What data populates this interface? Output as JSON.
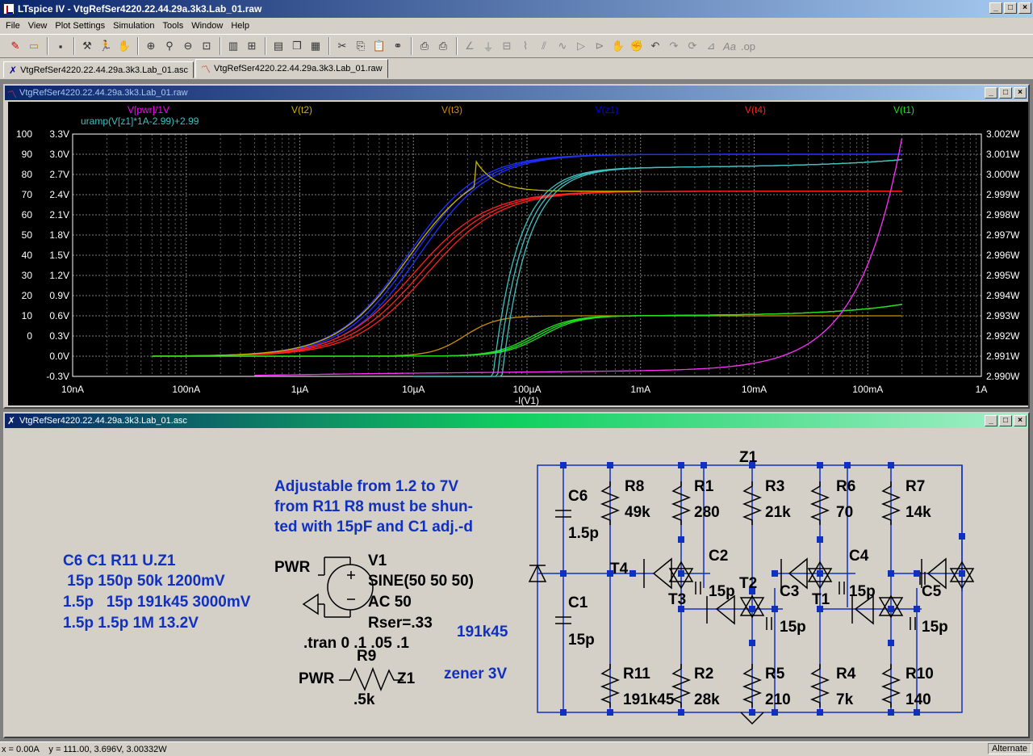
{
  "app": {
    "title": "LTspice IV - VtgRefSer4220.22.44.29a.3k3.Lab_01.raw"
  },
  "menu": [
    "File",
    "View",
    "Plot Settings",
    "Simulation",
    "Tools",
    "Window",
    "Help"
  ],
  "tabs": [
    {
      "label": "VtgRefSer4220.22.44.29a.3k3.Lab_01.asc",
      "icon": "schematic-icon"
    },
    {
      "label": "VtgRefSer4220.22.44.29a.3k3.Lab_01.raw",
      "icon": "waveform-icon"
    }
  ],
  "plot_window": {
    "title": "VtgRefSer4220.22.44.29a.3k3.Lab_01.raw"
  },
  "schematic_window": {
    "title": "VtgRefSer4220.22.44.29a.3k3.Lab_01.asc"
  },
  "chart_data": {
    "type": "line",
    "xlabel": "-I(V1)",
    "x_scale": "log",
    "xlim": [
      "10nA",
      "1A"
    ],
    "x_ticks": [
      "10nA",
      "100nA",
      "1µA",
      "10µA",
      "100µA",
      "1mA",
      "10mA",
      "100mA",
      "1A"
    ],
    "y_left_outer_ticks": [
      "100",
      "90",
      "80",
      "70",
      "60",
      "50",
      "40",
      "30",
      "20",
      "10",
      "0"
    ],
    "y_left_inner_ticks": [
      "3.3V",
      "3.0V",
      "2.7V",
      "2.4V",
      "2.1V",
      "1.8V",
      "1.5V",
      "1.2V",
      "0.9V",
      "0.6V",
      "0.3V",
      "0.0V",
      "-0.3V"
    ],
    "y_right_ticks": [
      "3.002W",
      "3.001W",
      "3.000W",
      "2.999W",
      "2.998W",
      "2.997W",
      "2.996W",
      "2.995W",
      "2.994W",
      "2.993W",
      "2.992W",
      "2.991W",
      "2.990W"
    ],
    "legend": [
      {
        "name": "V[pwr]/1V",
        "color": "#ff00ff"
      },
      {
        "name": "uramp(V[z1]*1A-2.99)+2.99",
        "color": "#40c0c0"
      },
      {
        "name": "V(t2)",
        "color": "#c8b400"
      },
      {
        "name": "V(t3)",
        "color": "#d09000"
      },
      {
        "name": "V(z1)",
        "color": "#0000ff"
      },
      {
        "name": "V(t4)",
        "color": "#ff2020"
      },
      {
        "name": "V(t1)",
        "color": "#20e020"
      }
    ],
    "grid": true
  },
  "schematic": {
    "note_title": "Adjustable from 1.2 to 7V",
    "note_line2": "from R11 R8 must be shun-",
    "note_line3": "ted with 15pF and C1 adj.-d",
    "table_header": "C6 C1 R11 U.Z1",
    "table_row1": " 15p 150p 50k 1200mV",
    "table_row2": "1.5p   15p 191k45 3000mV",
    "table_row3": "1.5p 1.5p 1M 13.2V",
    "pwr_label": "PWR",
    "v1_name": "V1",
    "v1_value": "SINE(50 50 50)",
    "v1_ac": "AC 50",
    "v1_rser": "Rser=.33",
    "tran": ".tran 0 .1 .05 .1",
    "r11_note": "191k45",
    "r9_name": "R9",
    "r9_pwr": "PWR",
    "r9_z1": "Z1",
    "r9_value": ".5k",
    "zener_note": "zener 3V",
    "z1": "Z1",
    "parts": {
      "C6": "C6",
      "C6v": "1.5p",
      "C1": "C1",
      "C1v": "15p",
      "R8": "R8",
      "R8v": "49k",
      "R1": "R1",
      "R1v": "280",
      "R3": "R3",
      "R3v": "21k",
      "R6": "R6",
      "R6v": "70",
      "R7": "R7",
      "R7v": "14k",
      "T4": "T4",
      "C2": "C2",
      "C2v": "15p",
      "T3": "T3",
      "T2": "T2",
      "C3": "C3",
      "C3v": "15p",
      "T1": "T1",
      "C4": "C4",
      "C4v": "15p",
      "C5": "C5",
      "C5v": "15p",
      "R11": "R11",
      "R11v": "191k45",
      "R2": "R2",
      "R2v": "28k",
      "R5": "R5",
      "R5v": "210",
      "R4": "R4",
      "R4v": "7k",
      "R10": "R10",
      "R10v": "140"
    }
  },
  "status": {
    "readout": "x = 0.00A    y = 111.00, 3.696V, 3.00332W",
    "mode": "Alternate"
  }
}
